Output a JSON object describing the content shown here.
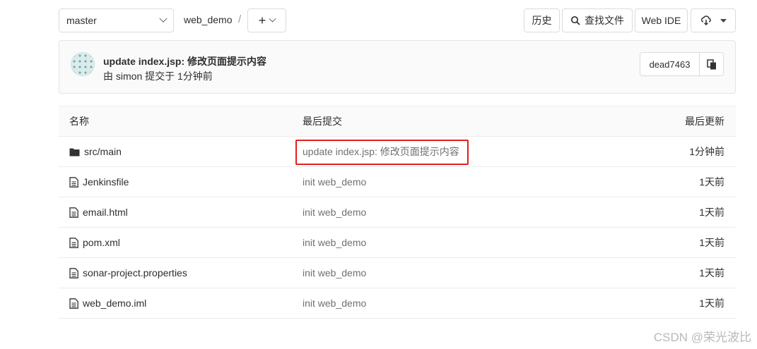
{
  "branch": {
    "value": "master"
  },
  "breadcrumb": {
    "project": "web_demo",
    "separator": "/",
    "add_label": "+"
  },
  "toolbar": {
    "history_label": "历史",
    "find_file_label": "查找文件",
    "web_ide_label": "Web IDE"
  },
  "last_commit": {
    "title": "update index.jsp: 修改页面提示内容",
    "meta": "由 simon 提交于 1分钟前",
    "sha": "dead7463"
  },
  "table": {
    "headers": {
      "name": "名称",
      "last_commit": "最后提交",
      "last_update": "最后更新"
    },
    "rows": [
      {
        "type": "folder",
        "name": "src/main",
        "commit": "update index.jsp: 修改页面提示内容",
        "updated": "1分钟前"
      },
      {
        "type": "file",
        "name": "Jenkinsfile",
        "commit": "init web_demo",
        "updated": "1天前"
      },
      {
        "type": "file",
        "name": "email.html",
        "commit": "init web_demo",
        "updated": "1天前"
      },
      {
        "type": "file",
        "name": "pom.xml",
        "commit": "init web_demo",
        "updated": "1天前"
      },
      {
        "type": "file",
        "name": "sonar-project.properties",
        "commit": "init web_demo",
        "updated": "1天前"
      },
      {
        "type": "file",
        "name": "web_demo.iml",
        "commit": "init web_demo",
        "updated": "1天前"
      }
    ]
  },
  "watermark": "CSDN @荣光波比",
  "colors": {
    "highlight": "#e0201e",
    "border": "#dbdbdb"
  }
}
